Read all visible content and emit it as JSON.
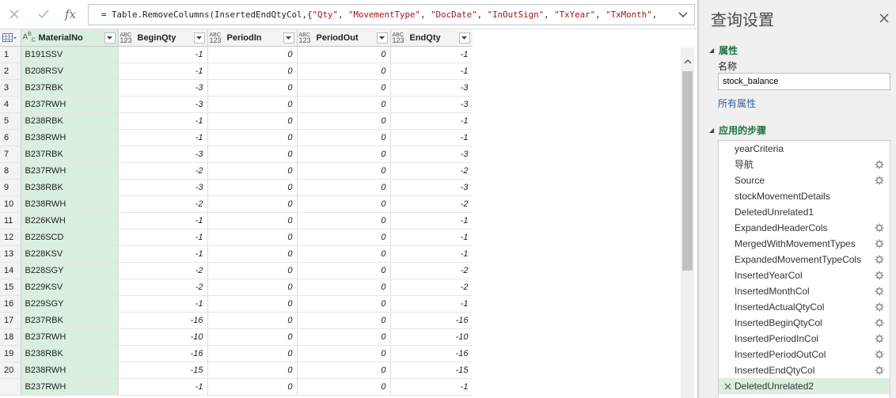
{
  "formula_bar": {
    "fx_label": "fx",
    "tokens": [
      {
        "t": "p",
        "v": "= Table.RemoveColumns(InsertedEndQtyCol,{"
      },
      {
        "t": "s",
        "v": "\"Qty\""
      },
      {
        "t": "p",
        "v": ", "
      },
      {
        "t": "s",
        "v": "\"MovementType\""
      },
      {
        "t": "p",
        "v": ", "
      },
      {
        "t": "s",
        "v": "\"DocDate\""
      },
      {
        "t": "p",
        "v": ", "
      },
      {
        "t": "s",
        "v": "\"InOutSign\""
      },
      {
        "t": "p",
        "v": ", "
      },
      {
        "t": "s",
        "v": "\"TxYear\""
      },
      {
        "t": "p",
        "v": ", "
      },
      {
        "t": "s",
        "v": "\"TxMonth\""
      },
      {
        "t": "p",
        "v": ","
      }
    ]
  },
  "grid": {
    "columns": [
      {
        "key": "MaterialNo",
        "label": "MaterialNo",
        "type": "ABC"
      },
      {
        "key": "BeginQty",
        "label": "BeginQty",
        "type": "ABC123"
      },
      {
        "key": "PeriodIn",
        "label": "PeriodIn",
        "type": "ABC123"
      },
      {
        "key": "PeriodOut",
        "label": "PeriodOut",
        "type": "ABC123"
      },
      {
        "key": "EndQty",
        "label": "EndQty",
        "type": "ABC123"
      }
    ],
    "type_icon_text": {
      "abc_top": "ABC",
      "num_bottom": "123",
      "abc_a": "A",
      "abc_b": "B",
      "abc_c": "C"
    },
    "rows": [
      {
        "n": "1",
        "mat": "B191SSV",
        "begin": "-1",
        "pin": "0",
        "pout": "0",
        "end": "-1"
      },
      {
        "n": "2",
        "mat": "B208RSV",
        "begin": "-1",
        "pin": "0",
        "pout": "0",
        "end": "-1"
      },
      {
        "n": "3",
        "mat": "B237RBK",
        "begin": "-3",
        "pin": "0",
        "pout": "0",
        "end": "-3"
      },
      {
        "n": "4",
        "mat": "B237RWH",
        "begin": "-3",
        "pin": "0",
        "pout": "0",
        "end": "-3"
      },
      {
        "n": "5",
        "mat": "B238RBK",
        "begin": "-1",
        "pin": "0",
        "pout": "0",
        "end": "-1"
      },
      {
        "n": "6",
        "mat": "B238RWH",
        "begin": "-1",
        "pin": "0",
        "pout": "0",
        "end": "-1"
      },
      {
        "n": "7",
        "mat": "B237RBK",
        "begin": "-3",
        "pin": "0",
        "pout": "0",
        "end": "-3"
      },
      {
        "n": "8",
        "mat": "B237RWH",
        "begin": "-2",
        "pin": "0",
        "pout": "0",
        "end": "-2"
      },
      {
        "n": "9",
        "mat": "B238RBK",
        "begin": "-3",
        "pin": "0",
        "pout": "0",
        "end": "-3"
      },
      {
        "n": "10",
        "mat": "B238RWH",
        "begin": "-2",
        "pin": "0",
        "pout": "0",
        "end": "-2"
      },
      {
        "n": "11",
        "mat": "B226KWH",
        "begin": "-1",
        "pin": "0",
        "pout": "0",
        "end": "-1"
      },
      {
        "n": "12",
        "mat": "B226SCD",
        "begin": "-1",
        "pin": "0",
        "pout": "0",
        "end": "-1"
      },
      {
        "n": "13",
        "mat": "B228KSV",
        "begin": "-1",
        "pin": "0",
        "pout": "0",
        "end": "-1"
      },
      {
        "n": "14",
        "mat": "B228SGY",
        "begin": "-2",
        "pin": "0",
        "pout": "0",
        "end": "-2"
      },
      {
        "n": "15",
        "mat": "B229KSV",
        "begin": "-2",
        "pin": "0",
        "pout": "0",
        "end": "-2"
      },
      {
        "n": "16",
        "mat": "B229SGY",
        "begin": "-1",
        "pin": "0",
        "pout": "0",
        "end": "-1"
      },
      {
        "n": "17",
        "mat": "B237RBK",
        "begin": "-16",
        "pin": "0",
        "pout": "0",
        "end": "-16"
      },
      {
        "n": "18",
        "mat": "B237RWH",
        "begin": "-10",
        "pin": "0",
        "pout": "0",
        "end": "-10"
      },
      {
        "n": "19",
        "mat": "B238RBK",
        "begin": "-16",
        "pin": "0",
        "pout": "0",
        "end": "-16"
      },
      {
        "n": "20",
        "mat": "B238RWH",
        "begin": "-15",
        "pin": "0",
        "pout": "0",
        "end": "-15"
      },
      {
        "n": "",
        "mat": "B237RWH",
        "begin": "-1",
        "pin": "0",
        "pout": "0",
        "end": "-1"
      }
    ]
  },
  "pane": {
    "title": "查询设置",
    "properties_header": "属性",
    "name_label": "名称",
    "name_value": "stock_balance",
    "all_properties_link": "所有属性",
    "steps_header": "应用的步骤",
    "steps": [
      {
        "label": "yearCriteria",
        "gear": false,
        "selected": false
      },
      {
        "label": "导航",
        "gear": true,
        "selected": false
      },
      {
        "label": "Source",
        "gear": true,
        "selected": false
      },
      {
        "label": "stockMovementDetails",
        "gear": false,
        "selected": false
      },
      {
        "label": "DeletedUnrelated1",
        "gear": false,
        "selected": false
      },
      {
        "label": "ExpandedHeaderCols",
        "gear": true,
        "selected": false
      },
      {
        "label": "MergedWithMovementTypes",
        "gear": true,
        "selected": false
      },
      {
        "label": "ExpandedMovementTypeCols",
        "gear": true,
        "selected": false
      },
      {
        "label": "InsertedYearCol",
        "gear": true,
        "selected": false
      },
      {
        "label": "InsertedMonthCol",
        "gear": true,
        "selected": false
      },
      {
        "label": "InsertedActualQtyCol",
        "gear": true,
        "selected": false
      },
      {
        "label": "InsertedBeginQtyCol",
        "gear": true,
        "selected": false
      },
      {
        "label": "InsertedPeriodInCol",
        "gear": true,
        "selected": false
      },
      {
        "label": "InsertedPeriodOutCol",
        "gear": true,
        "selected": false
      },
      {
        "label": "InsertedEndQtyCol",
        "gear": true,
        "selected": false
      },
      {
        "label": "DeletedUnrelated2",
        "gear": false,
        "selected": true
      }
    ]
  },
  "colors": {
    "accent_green": "#217346",
    "material_col_bg": "#d9efe0",
    "string_token": "#a31515",
    "link_blue": "#2e5e9a"
  },
  "icons": {
    "cancel": "close-x-icon",
    "confirm": "checkmark-icon",
    "expand": "chevron-down-icon",
    "table_corner": "table-grid-icon",
    "filter": "dropdown-arrow-icon",
    "step_settings": "gear-icon",
    "step_delete": "close-x-icon",
    "pane_close": "close-x-icon",
    "scroll_up": "chevron-up-icon"
  }
}
